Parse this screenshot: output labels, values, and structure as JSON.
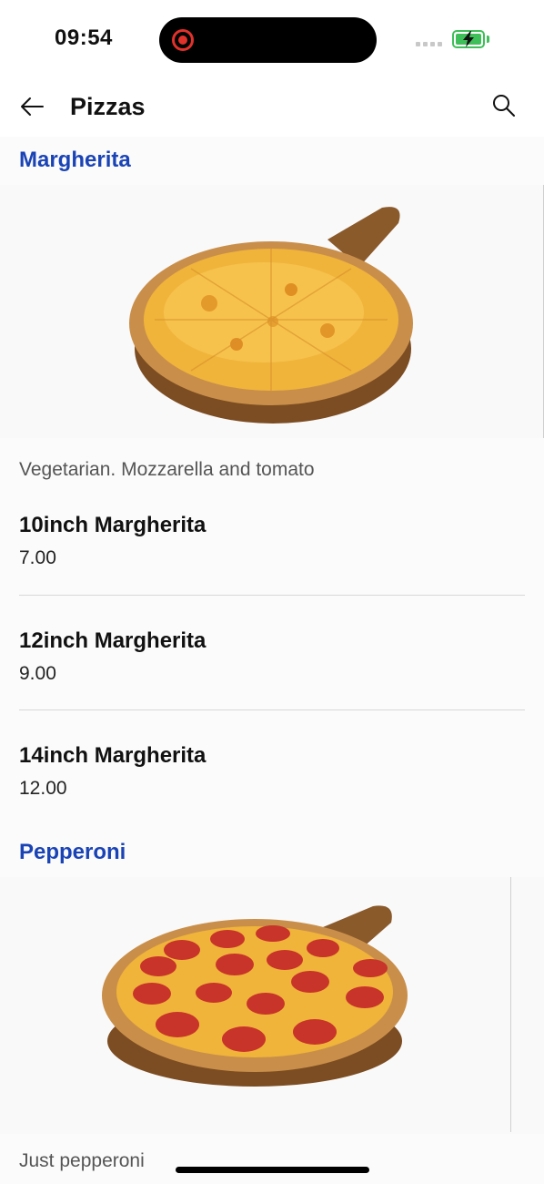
{
  "status_bar": {
    "time": "09:54",
    "battery_color": "#3fbf5a",
    "icons": [
      "screen-recording-icon",
      "signal-icon",
      "battery-charging-icon"
    ]
  },
  "header": {
    "title": "Pizzas",
    "back_icon": "arrow-left-icon",
    "search_icon": "search-icon"
  },
  "accent_color": "#1a43b5",
  "sections": [
    {
      "title": "Margherita",
      "image": "margherita-pizza-image",
      "description": "Vegetarian. Mozzarella and tomato",
      "items": [
        {
          "name": "10inch Margherita",
          "price": "7.00"
        },
        {
          "name": "12inch Margherita",
          "price": "9.00"
        },
        {
          "name": "14inch Margherita",
          "price": "12.00"
        }
      ]
    },
    {
      "title": "Pepperoni",
      "image": "pepperoni-pizza-image",
      "description": "Just pepperoni"
    }
  ]
}
